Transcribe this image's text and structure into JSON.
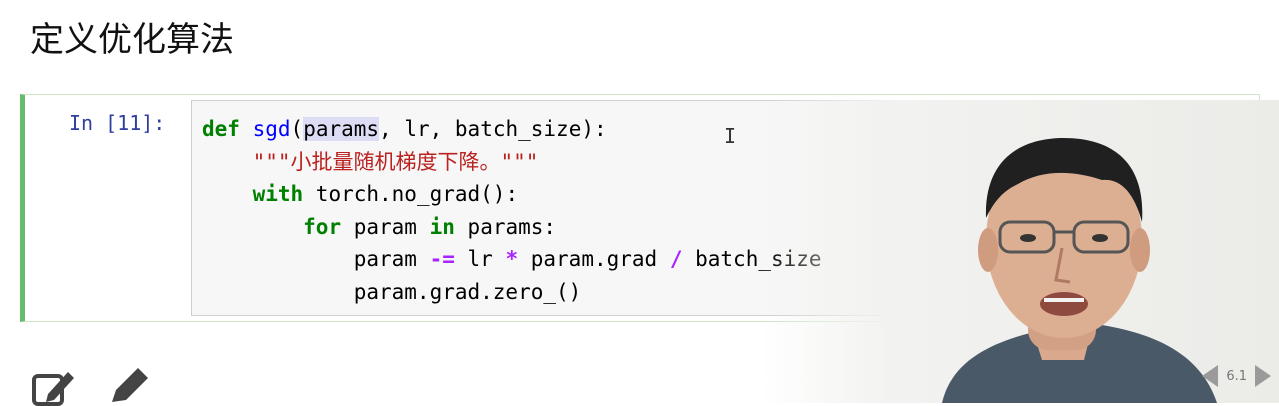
{
  "heading": "定义优化算法",
  "cell": {
    "prompt": "In [11]:",
    "lines": [
      {
        "kw1": "def",
        "sp1": " ",
        "fn": "sgd",
        "p1": "(",
        "hl": "params",
        "rest": ", lr, batch_size):"
      },
      {
        "indent": "    ",
        "str": "\"\"\"小批量随机梯度下降。\"\"\""
      },
      {
        "indent": "    ",
        "kw": "with",
        "rest": " torch.no_grad():"
      },
      {
        "indent": "        ",
        "kw": "for",
        "mid1": " param ",
        "kw2": "in",
        "rest": " params:"
      },
      {
        "indent": "            ",
        "a": "param ",
        "op1": "-=",
        "b": " lr ",
        "op2": "*",
        "c": " param.grad ",
        "op3": "/",
        "d": " batch_size"
      },
      {
        "indent": "            ",
        "a": "param.grad.zero_()"
      }
    ]
  },
  "slide": {
    "number": "6.1"
  },
  "icons": [
    "edit-icon",
    "pencil-icon",
    "prev-slide-icon",
    "next-slide-icon"
  ],
  "colors": {
    "keyword": "#008000",
    "function": "#0000ff",
    "string": "#ba2121",
    "operator": "#aa22ff",
    "prompt": "#303f9f",
    "cell_border": "#66bb6a"
  }
}
